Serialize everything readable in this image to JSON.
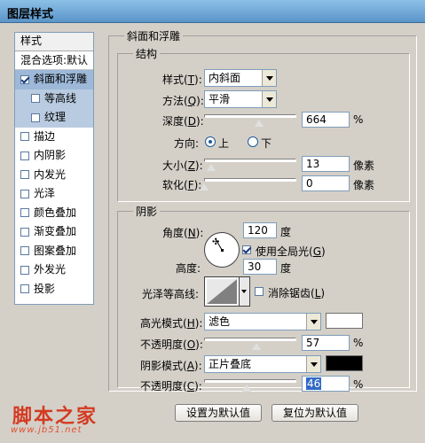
{
  "window": {
    "title": "图层样式"
  },
  "sidebar": {
    "header": "样式",
    "blend_options": "混合选项:默认",
    "items": [
      {
        "label": "斜面和浮雕",
        "checked": true,
        "selected": true
      },
      {
        "label": "等高线",
        "checked": false,
        "sub": true
      },
      {
        "label": "纹理",
        "checked": false,
        "sub": true
      },
      {
        "label": "描边",
        "checked": false
      },
      {
        "label": "内阴影",
        "checked": false
      },
      {
        "label": "内发光",
        "checked": false
      },
      {
        "label": "光泽",
        "checked": false
      },
      {
        "label": "颜色叠加",
        "checked": false
      },
      {
        "label": "渐变叠加",
        "checked": false
      },
      {
        "label": "图案叠加",
        "checked": false
      },
      {
        "label": "外发光",
        "checked": false
      },
      {
        "label": "投影",
        "checked": false
      }
    ]
  },
  "bevel": {
    "group_title": "斜面和浮雕",
    "structure": {
      "title": "结构",
      "style_label": "样式(",
      "style_key": "T",
      "style_value": "内斜面",
      "technique_label": "方法(",
      "technique_key": "Q",
      "technique_value": "平滑",
      "depth_label": "深度(",
      "depth_key": "D",
      "depth_value": "664",
      "depth_unit": "%",
      "depth_pos": 0.6,
      "direction_label": "方向:",
      "dir_up": "上",
      "dir_down": "下",
      "size_label": "大小(",
      "size_key": "Z",
      "size_value": "13",
      "size_unit": "像素",
      "size_pos": 0.08,
      "soften_label": "软化(",
      "soften_key": "F",
      "soften_value": "0",
      "soften_unit": "像素",
      "soften_pos": 0.0
    },
    "shading": {
      "title": "阴影",
      "angle_label": "角度(",
      "angle_key": "N",
      "angle_value": "120",
      "angle_unit": "度",
      "global_light_label": "使用全局光(",
      "global_light_key": "G",
      "global_light_checked": true,
      "altitude_label": "高度:",
      "altitude_value": "30",
      "altitude_unit": "度",
      "gloss_label": "光泽等高线:",
      "antialias_label": "消除锯齿(",
      "antialias_key": "L",
      "highlight_mode_label": "高光模式(",
      "highlight_mode_key": "H",
      "highlight_mode_value": "滤色",
      "highlight_color": "#ffffff",
      "highlight_opacity_label": "不透明度(",
      "highlight_opacity_key": "O",
      "highlight_opacity_value": "57",
      "highlight_opacity_unit": "%",
      "highlight_opacity_pos": 0.57,
      "shadow_mode_label": "阴影模式(",
      "shadow_mode_key": "A",
      "shadow_mode_value": "正片叠底",
      "shadow_color": "#000000",
      "shadow_opacity_label": "不透明度(",
      "shadow_opacity_key": "C",
      "shadow_opacity_value": "46",
      "shadow_opacity_unit": "%",
      "shadow_opacity_pos": 0.46
    },
    "make_default": "设置为默认值",
    "reset_default": "复位为默认值"
  },
  "watermark": {
    "text": "脚本之家",
    "url": "www.jb51.net"
  }
}
